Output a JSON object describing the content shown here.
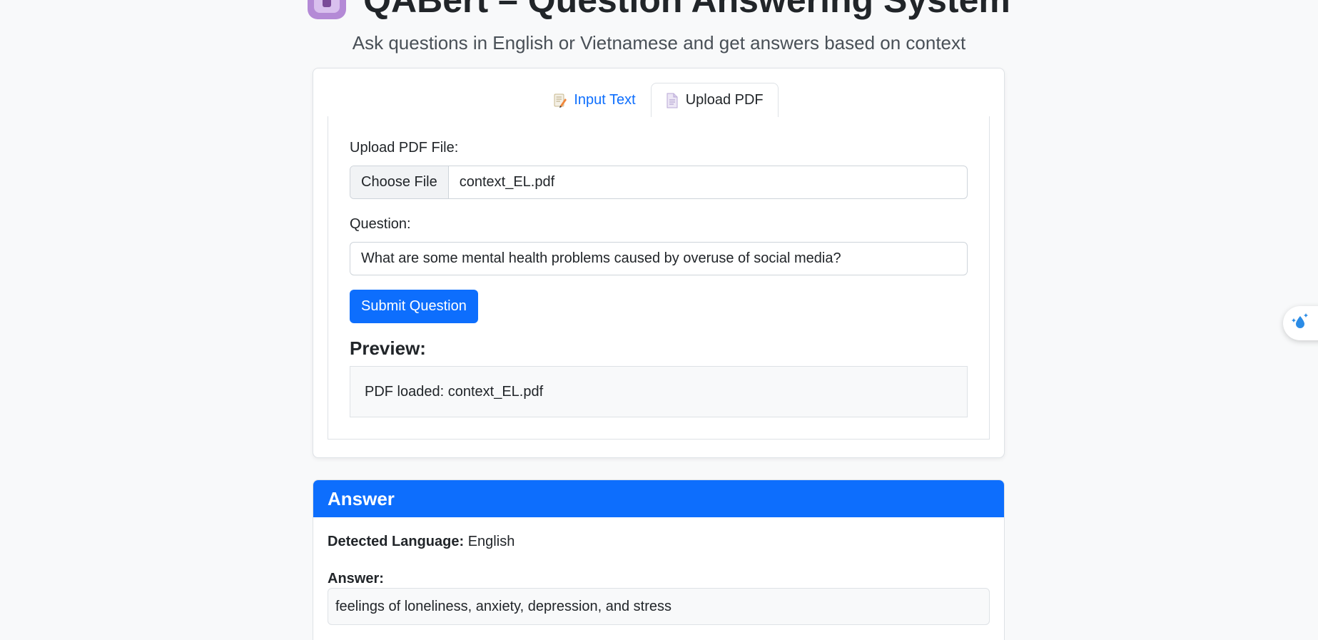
{
  "header": {
    "title": "QABert – Question Answering System",
    "subtitle": "Ask questions in English or Vietnamese and get answers based on context"
  },
  "tabs": [
    {
      "label": "Input Text",
      "icon": "memo-pencil-icon",
      "active": false
    },
    {
      "label": "Upload PDF",
      "icon": "document-icon",
      "active": true
    }
  ],
  "upload": {
    "label": "Upload PDF File:",
    "choose_label": "Choose File",
    "file_name": "context_EL.pdf"
  },
  "question": {
    "label": "Question:",
    "value": "What are some mental health problems caused by overuse of social media?"
  },
  "submit_label": "Submit Question",
  "preview": {
    "title": "Preview:",
    "text": "PDF loaded: context_EL.pdf"
  },
  "answer": {
    "header": "Answer",
    "lang_label": "Detected Language:",
    "lang_value": "English",
    "answer_label": "Answer:",
    "answer_text": "feelings of loneliness, anxiety, depression, and stress"
  },
  "colors": {
    "accent": "#0d6efd",
    "background": "#f8f9fa"
  }
}
